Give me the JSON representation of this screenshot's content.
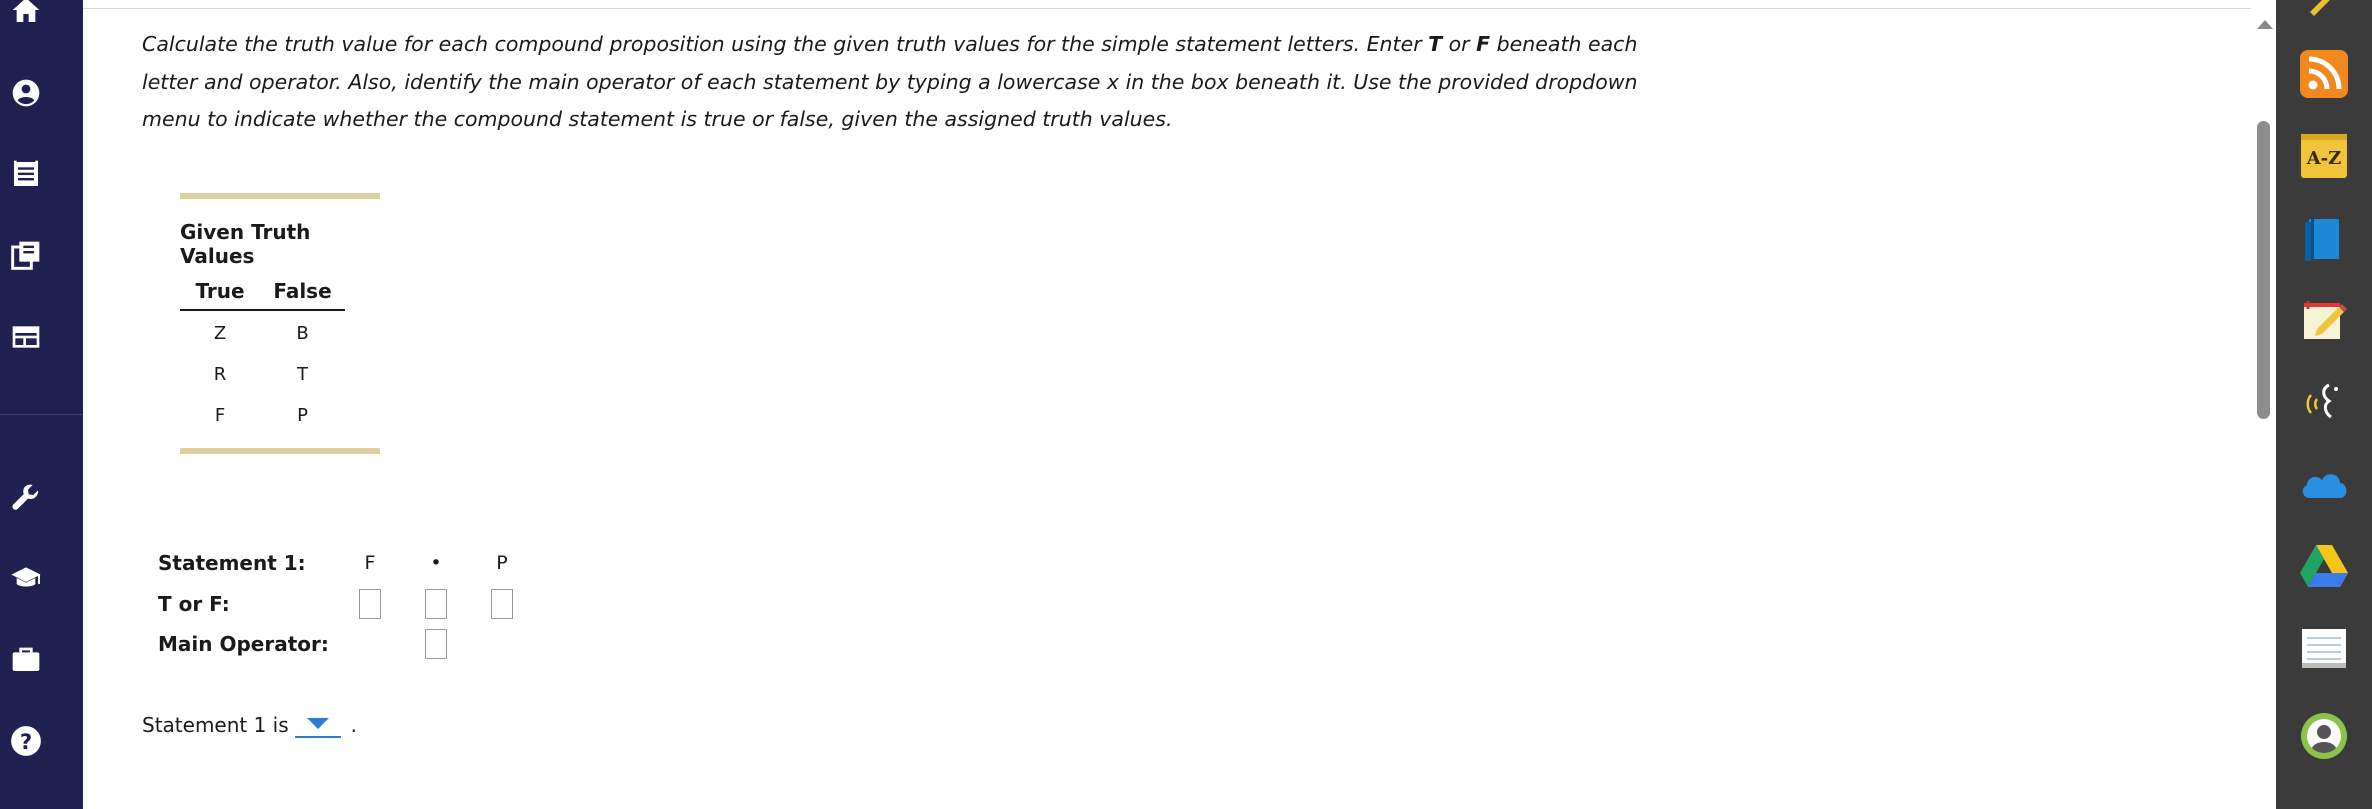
{
  "left_nav": {
    "items": [
      {
        "name": "home",
        "icon": "home-icon"
      },
      {
        "name": "account",
        "icon": "user-circle-icon"
      },
      {
        "name": "assignments",
        "icon": "list-icon"
      },
      {
        "name": "library",
        "icon": "books-icon"
      },
      {
        "name": "gradebook",
        "icon": "card-icon"
      },
      {
        "name": "tools",
        "icon": "wrench-icon"
      },
      {
        "name": "courses",
        "icon": "graduation-cap-icon"
      },
      {
        "name": "portfolio",
        "icon": "briefcase-icon"
      },
      {
        "name": "help",
        "icon": "help-icon"
      }
    ]
  },
  "instructions": {
    "part1": "Calculate the truth value for each compound proposition using the given truth values for the simple statement letters. Enter ",
    "t": "T",
    "or": " or ",
    "f": "F",
    "part2": " beneath each letter and operator. Also, identify the main operator of each statement by typing a lowercase x in the box beneath it. Use the provided dropdown menu to indicate whether the compound statement is true or false, given the assigned truth values."
  },
  "truth_table": {
    "title": "Given Truth Values",
    "header_true": "True",
    "header_false": "False",
    "rows": [
      {
        "true": "Z",
        "false": "B"
      },
      {
        "true": "R",
        "false": "T"
      },
      {
        "true": "F",
        "false": "P"
      }
    ]
  },
  "statement": {
    "label": "Statement 1:",
    "symbols": [
      "F",
      "•",
      "P"
    ],
    "tf_label": "T or F:",
    "main_op_label": "Main Operator:",
    "result_prefix": "Statement 1 is",
    "result_value": "",
    "result_suffix": "."
  },
  "right_dock": {
    "items": [
      {
        "name": "rss",
        "icon": "rss-icon"
      },
      {
        "name": "a-z",
        "icon": "a-z-icon",
        "label": "A-Z"
      },
      {
        "name": "ebook",
        "icon": "book-icon"
      },
      {
        "name": "notes",
        "icon": "notepad-pencil-icon"
      },
      {
        "name": "read-aloud",
        "icon": "speech-icon"
      },
      {
        "name": "onedrive",
        "icon": "cloud-icon"
      },
      {
        "name": "google-drive",
        "icon": "drive-icon"
      },
      {
        "name": "notebook",
        "icon": "notebook-icon"
      },
      {
        "name": "profile",
        "icon": "avatar-icon"
      }
    ]
  },
  "colors": {
    "nav_bg": "#1f2150",
    "dock_bg": "#3b3b3b",
    "table_bar": "#dccfa4",
    "dropdown_accent": "#2e7bd1"
  }
}
